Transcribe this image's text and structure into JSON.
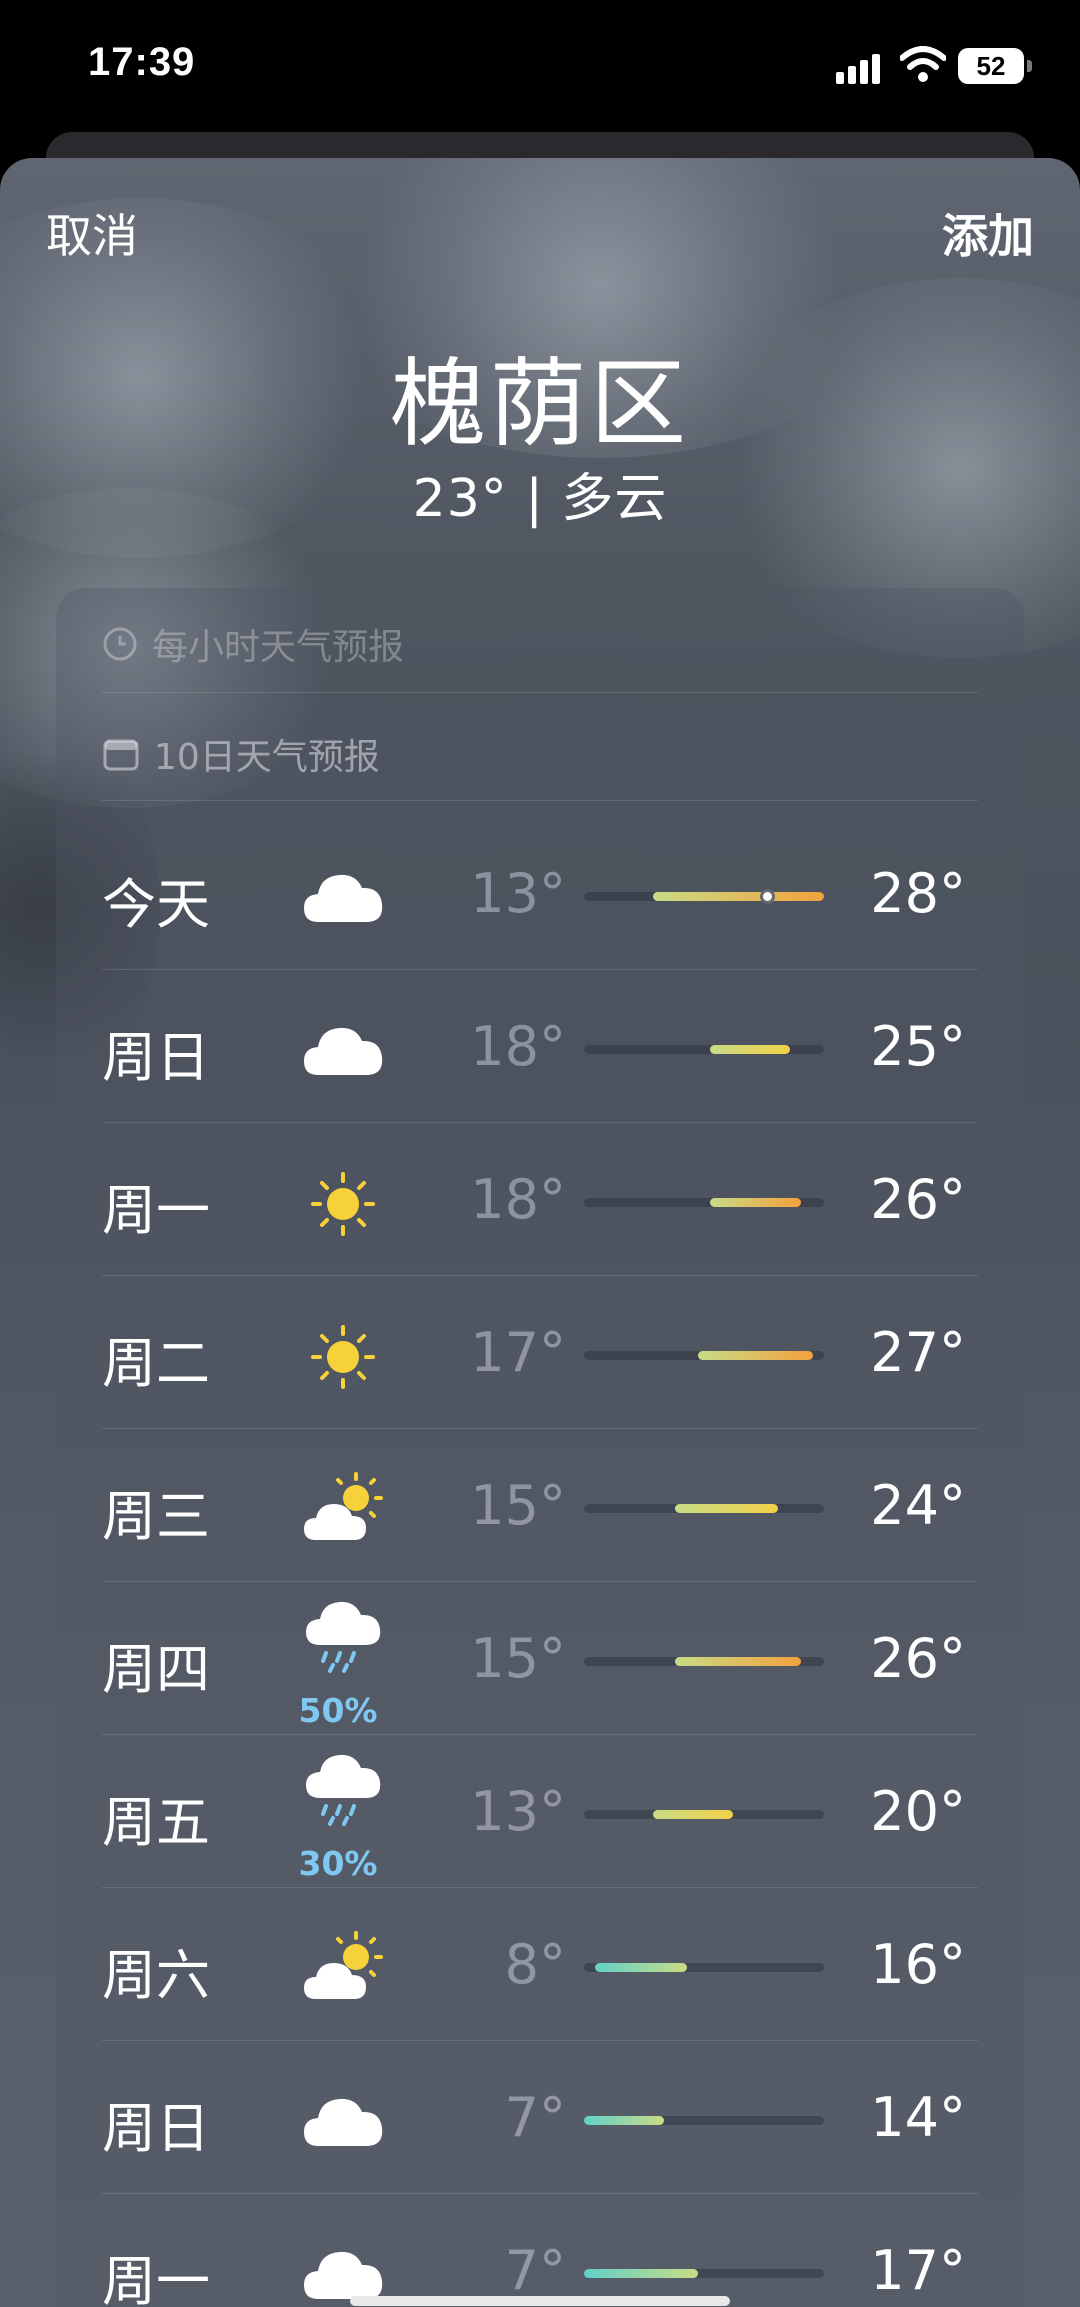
{
  "status": {
    "time": "17:39",
    "battery": "52"
  },
  "nav": {
    "cancel": "取消",
    "add": "添加"
  },
  "location": {
    "city": "槐荫区",
    "subtitle": "23° | 多云"
  },
  "sections": {
    "hourly": "每小时天气预报",
    "tenday": "10日天气预报"
  },
  "scale": {
    "min": 7,
    "max": 28,
    "current": 23
  },
  "forecast": [
    {
      "day": "今天",
      "icon": "cloud-icon",
      "low": "13°",
      "high": "28°",
      "lo": 13,
      "hi": 28,
      "pct": "",
      "current": true
    },
    {
      "day": "周日",
      "icon": "cloud-icon",
      "low": "18°",
      "high": "25°",
      "lo": 18,
      "hi": 25,
      "pct": ""
    },
    {
      "day": "周一",
      "icon": "sun-icon",
      "low": "18°",
      "high": "26°",
      "lo": 18,
      "hi": 26,
      "pct": ""
    },
    {
      "day": "周二",
      "icon": "sun-icon",
      "low": "17°",
      "high": "27°",
      "lo": 17,
      "hi": 27,
      "pct": ""
    },
    {
      "day": "周三",
      "icon": "partly-sunny-icon",
      "low": "15°",
      "high": "24°",
      "lo": 15,
      "hi": 24,
      "pct": ""
    },
    {
      "day": "周四",
      "icon": "rain-cloud-icon",
      "low": "15°",
      "high": "26°",
      "lo": 15,
      "hi": 26,
      "pct": "50%"
    },
    {
      "day": "周五",
      "icon": "rain-cloud-icon",
      "low": "13°",
      "high": "20°",
      "lo": 13,
      "hi": 20,
      "pct": "30%"
    },
    {
      "day": "周六",
      "icon": "partly-sunny-icon",
      "low": "8°",
      "high": "16°",
      "lo": 8,
      "hi": 16,
      "pct": ""
    },
    {
      "day": "周日",
      "icon": "cloud-icon",
      "low": "7°",
      "high": "14°",
      "lo": 7,
      "hi": 14,
      "pct": ""
    },
    {
      "day": "周一",
      "icon": "cloud-icon",
      "low": "7°",
      "high": "17°",
      "lo": 7,
      "hi": 17,
      "pct": ""
    }
  ],
  "colors": {
    "cool": "#62d0c8",
    "mild": "#c9dc86",
    "warm": "#f2d048",
    "hot": "#f3a13c"
  }
}
